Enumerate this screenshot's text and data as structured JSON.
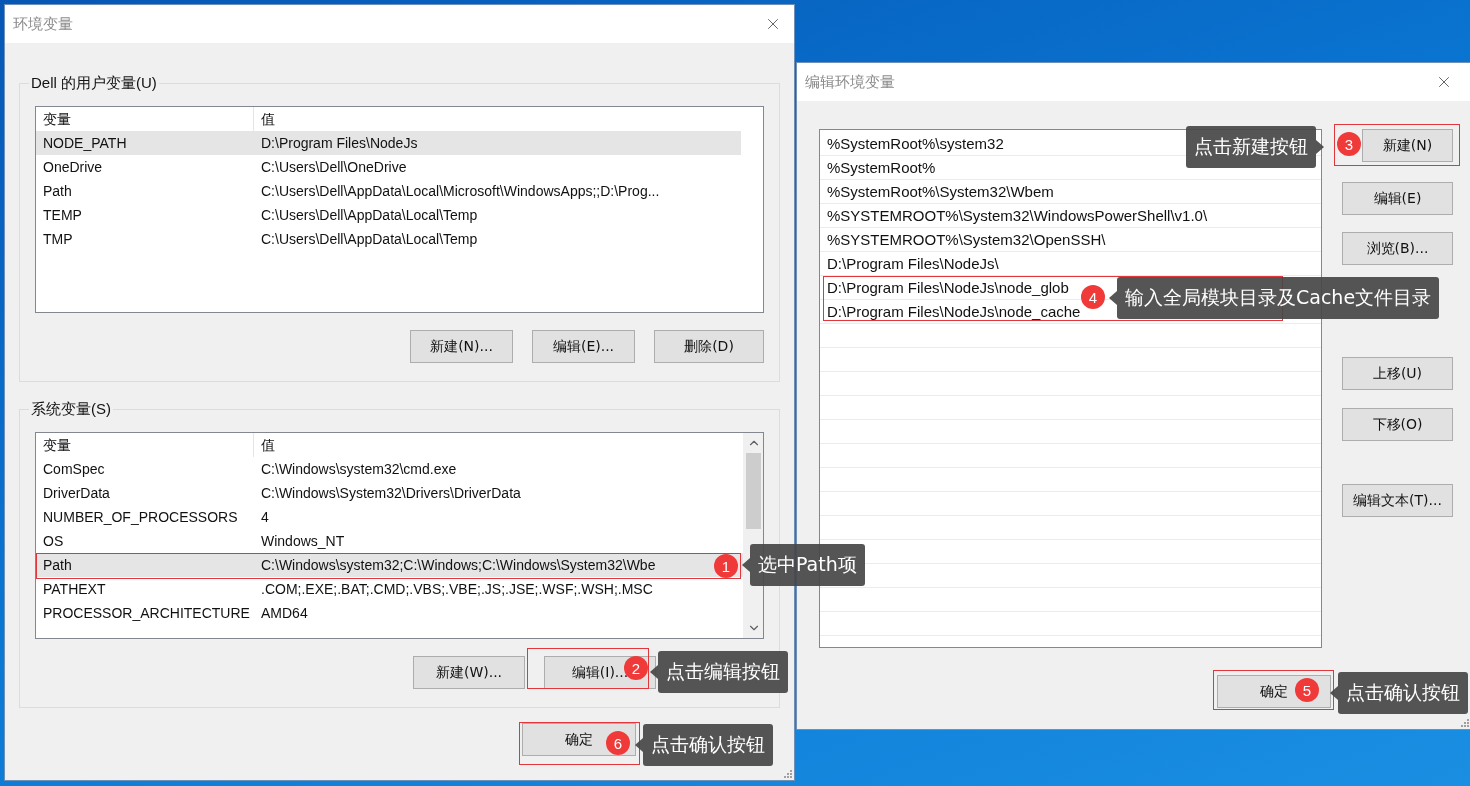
{
  "env_window": {
    "title": "环境变量",
    "groups": [
      {
        "label": "Dell 的用户变量(U)",
        "columns": [
          "变量",
          "值"
        ],
        "rows": [
          {
            "name": "NODE_PATH",
            "value": "D:\\Program Files\\NodeJs",
            "selected": true
          },
          {
            "name": "OneDrive",
            "value": "C:\\Users\\Dell\\OneDrive",
            "selected": false
          },
          {
            "name": "Path",
            "value": "C:\\Users\\Dell\\AppData\\Local\\Microsoft\\WindowsApps;;D:\\Prog...",
            "selected": false
          },
          {
            "name": "TEMP",
            "value": "C:\\Users\\Dell\\AppData\\Local\\Temp",
            "selected": false
          },
          {
            "name": "TMP",
            "value": "C:\\Users\\Dell\\AppData\\Local\\Temp",
            "selected": false
          }
        ],
        "buttons": [
          "新建(N)...",
          "编辑(E)...",
          "删除(D)"
        ]
      },
      {
        "label": "系统变量(S)",
        "columns": [
          "变量",
          "值"
        ],
        "rows": [
          {
            "name": "ComSpec",
            "value": "C:\\Windows\\system32\\cmd.exe",
            "selected": false
          },
          {
            "name": "DriverData",
            "value": "C:\\Windows\\System32\\Drivers\\DriverData",
            "selected": false
          },
          {
            "name": "NUMBER_OF_PROCESSORS",
            "value": "4",
            "selected": false
          },
          {
            "name": "OS",
            "value": "Windows_NT",
            "selected": false
          },
          {
            "name": "Path",
            "value": "C:\\Windows\\system32;C:\\Windows;C:\\Windows\\System32\\Wbe",
            "selected": true
          },
          {
            "name": "PATHEXT",
            "value": ".COM;.EXE;.BAT;.CMD;.VBS;.VBE;.JS;.JSE;.WSF;.WSH;.MSC",
            "selected": false
          },
          {
            "name": "PROCESSOR_ARCHITECTURE",
            "value": "AMD64",
            "selected": false
          }
        ],
        "buttons": [
          "新建(W)...",
          "编辑(I)..."
        ]
      }
    ],
    "footer_buttons": [
      "确定"
    ]
  },
  "edit_window": {
    "title": "编辑环境变量",
    "items": [
      "%SystemRoot%\\system32",
      "%SystemRoot%",
      "%SystemRoot%\\System32\\Wbem",
      "%SYSTEMROOT%\\System32\\WindowsPowerShell\\v1.0\\",
      "%SYSTEMROOT%\\System32\\OpenSSH\\",
      "D:\\Program Files\\NodeJs\\",
      "D:\\Program Files\\NodeJs\\node_glob",
      "D:\\Program Files\\NodeJs\\node_cache"
    ],
    "buttons": [
      "新建(N)",
      "编辑(E)",
      "浏览(B)...",
      "上移(U)",
      "下移(O)",
      "编辑文本(T)..."
    ],
    "footer_buttons": [
      "确定"
    ]
  },
  "annotations": [
    {
      "number": "1",
      "text": "选中Path项"
    },
    {
      "number": "2",
      "text": "点击编辑按钮"
    },
    {
      "number": "3",
      "text": "点击新建按钮"
    },
    {
      "number": "4",
      "text": "输入全局模块目录及Cache文件目录"
    },
    {
      "number": "5",
      "text": "点击确认按钮"
    },
    {
      "number": "6",
      "text": "点击确认按钮"
    }
  ]
}
